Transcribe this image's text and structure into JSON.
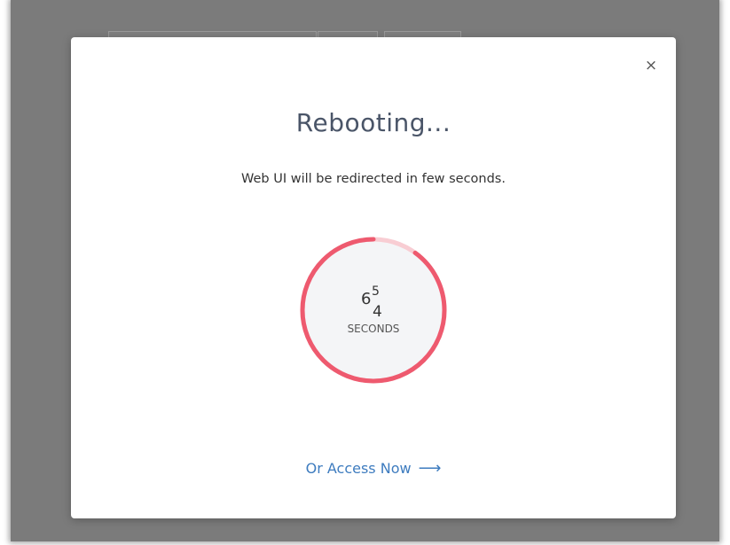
{
  "dialog": {
    "title": "Rebooting...",
    "message": "Web UI will be redirected in few seconds.",
    "close_glyph": "×",
    "access_link_label": "Or Access Now",
    "access_link_arrow": "⟶"
  },
  "countdown": {
    "digit_main": "6",
    "digit_superscript": "5",
    "digit_subscript": "4",
    "unit_label": "SECONDS",
    "progress_fraction": 0.9
  },
  "colors": {
    "ring_active": "#ee5a6f",
    "ring_track": "#f8cdd3",
    "ring_fill": "#f4f5f7",
    "link": "#3e7cbf",
    "title": "#4a5568",
    "backdrop": "#7b7b7b"
  },
  "icons": {
    "close": "close-icon",
    "arrow": "arrow-right-icon"
  }
}
